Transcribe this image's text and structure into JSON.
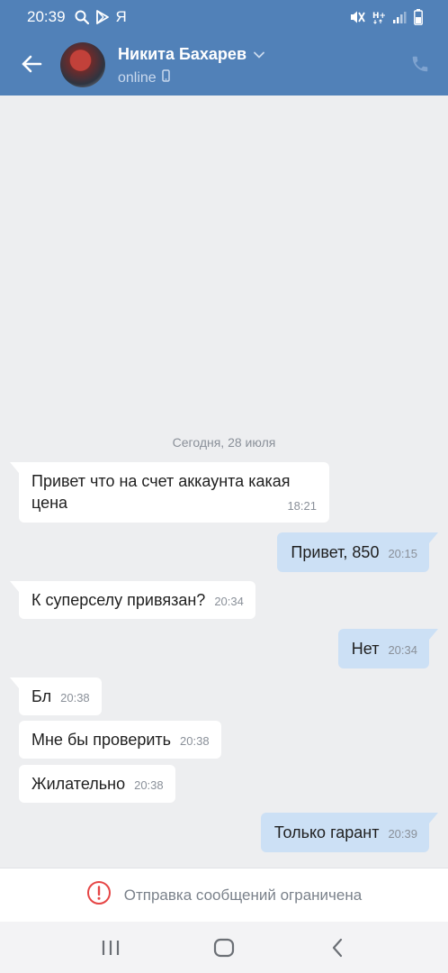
{
  "status_bar": {
    "time": "20:39",
    "left_icons": [
      "search-icon",
      "play-store-icon"
    ],
    "carrier_glyph": "Я",
    "right_icons": [
      "mute-icon",
      "hplus-icon",
      "signal-icon",
      "battery-icon"
    ]
  },
  "header": {
    "contact_name": "Никита Бахарев",
    "status": "online",
    "colors": {
      "bar": "#5181b8"
    }
  },
  "chat": {
    "date_separator": "Сегодня, 28 июля",
    "messages": [
      {
        "direction": "in",
        "text": "Привет что на счет аккаунта какая цена",
        "time": "18:21"
      },
      {
        "direction": "out",
        "text": "Привет, 850",
        "time": "20:15"
      },
      {
        "direction": "in",
        "text": "К суперселу привязан?",
        "time": "20:34"
      },
      {
        "direction": "out",
        "text": "Нет",
        "time": "20:34"
      },
      {
        "direction": "in",
        "text": "Бл",
        "time": "20:38"
      },
      {
        "direction": "in",
        "text": "Мне бы проверить",
        "time": "20:38"
      },
      {
        "direction": "in",
        "text": "Жилательно",
        "time": "20:38"
      },
      {
        "direction": "out",
        "text": "Только гарант",
        "time": "20:39"
      }
    ],
    "colors": {
      "incoming": "#ffffff",
      "outgoing": "#cce0f5",
      "background": "#edeef0"
    }
  },
  "restriction": {
    "text": "Отправка сообщений ограничена",
    "icon": "warning-circle-icon",
    "icon_color": "#e64646"
  },
  "nav_bar": {
    "icons": [
      "recent-apps-icon",
      "home-icon",
      "back-icon"
    ]
  }
}
